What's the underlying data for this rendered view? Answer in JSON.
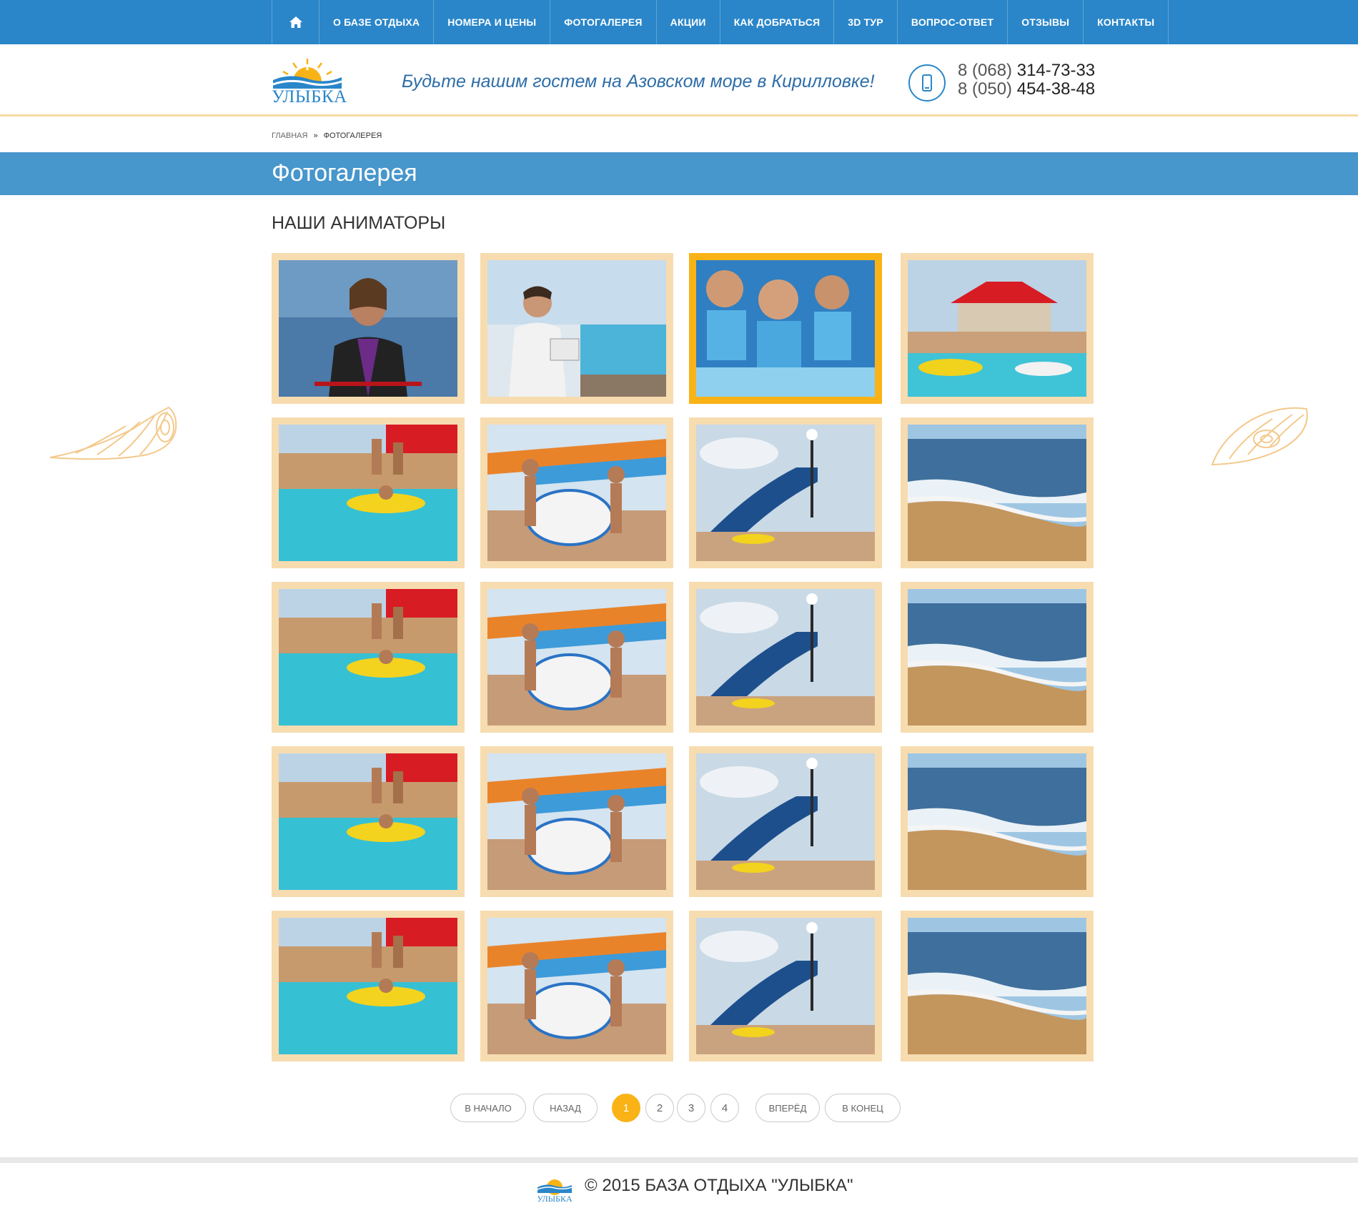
{
  "nav": {
    "home_icon": "home-icon",
    "items": [
      "О базе отдыха",
      "Номера и цены",
      "Фотогалерея",
      "Акции",
      "Как добраться",
      "3D тур",
      "Вопрос-ответ",
      "Отзывы",
      "Контакты"
    ]
  },
  "header": {
    "logo_text": "УЛЫБКА",
    "slogan": "Будьте нашим гостем на Азовском море в Кирилловке!",
    "phone_icon": "mobile-phone-icon",
    "phone1_code": "8 (068)",
    "phone1_number": "314-73-33",
    "phone2_code": "8 (050)",
    "phone2_number": "454-38-48"
  },
  "breadcrumb": {
    "home": "Главная",
    "separator": "»",
    "current": "Фотогалерея"
  },
  "page": {
    "title": "Фотогалерея",
    "section_title": "Наши аниматоры"
  },
  "gallery": {
    "photos": [
      "woman-wakeboarder-photo",
      "man-with-tablet-poolside-photo",
      "kids-in-life-vests-photo",
      "beach-cafe-pool-photo",
      "pool-inflatable-photo",
      "waterpark-girls-photo",
      "water-slide-photo",
      "sea-shore-photo",
      "pool-inflatable-photo",
      "waterpark-girls-photo",
      "water-slide-photo",
      "sea-shore-photo",
      "pool-inflatable-photo",
      "waterpark-girls-photo",
      "water-slide-photo",
      "sea-shore-photo",
      "pool-inflatable-photo",
      "waterpark-girls-photo",
      "water-slide-photo",
      "sea-shore-photo"
    ],
    "active_index": 2
  },
  "pagination": {
    "first": "В начало",
    "prev": "Назад",
    "pages": [
      "1",
      "2",
      "3",
      "4"
    ],
    "current": "1",
    "next": "Вперёд",
    "last": "В конец"
  },
  "footer": {
    "logo_text": "УЛЫБКА",
    "copyright": "© 2015 БАЗА ОТДЫХА \"УЛЫБКА\""
  },
  "colors": {
    "primary_blue": "#2a86c9",
    "title_band": "#4796cc",
    "accent_orange": "#f9b316",
    "frame_sand": "#f7dcb0"
  }
}
